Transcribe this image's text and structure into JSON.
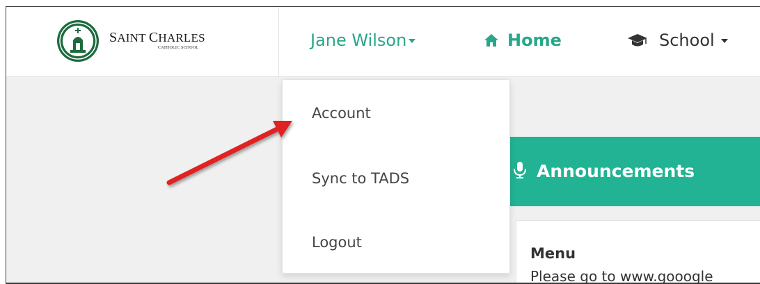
{
  "brand": {
    "name_first_cap": "S",
    "name_rest": "AINT ",
    "name_second_cap": "C",
    "name_rest2": "HARLES",
    "subtitle": "CATHOLIC SCHOOL"
  },
  "navbar": {
    "user_name": "Jane Wilson",
    "home_label": "Home",
    "school_label": "School"
  },
  "user_dropdown": {
    "items": [
      {
        "label": "Account"
      },
      {
        "label": "Sync to TADS"
      },
      {
        "label": "Logout"
      }
    ]
  },
  "announcements": {
    "title": "Announcements",
    "menu_heading": "Menu",
    "menu_text": "Please go to www.gooogle"
  },
  "colors": {
    "accent": "#27a789",
    "announce_bar": "#21b394",
    "arrow": "#e02020"
  },
  "icons": {
    "home": "home-icon",
    "school": "graduation-cap-icon",
    "announcements": "microphone-icon"
  }
}
